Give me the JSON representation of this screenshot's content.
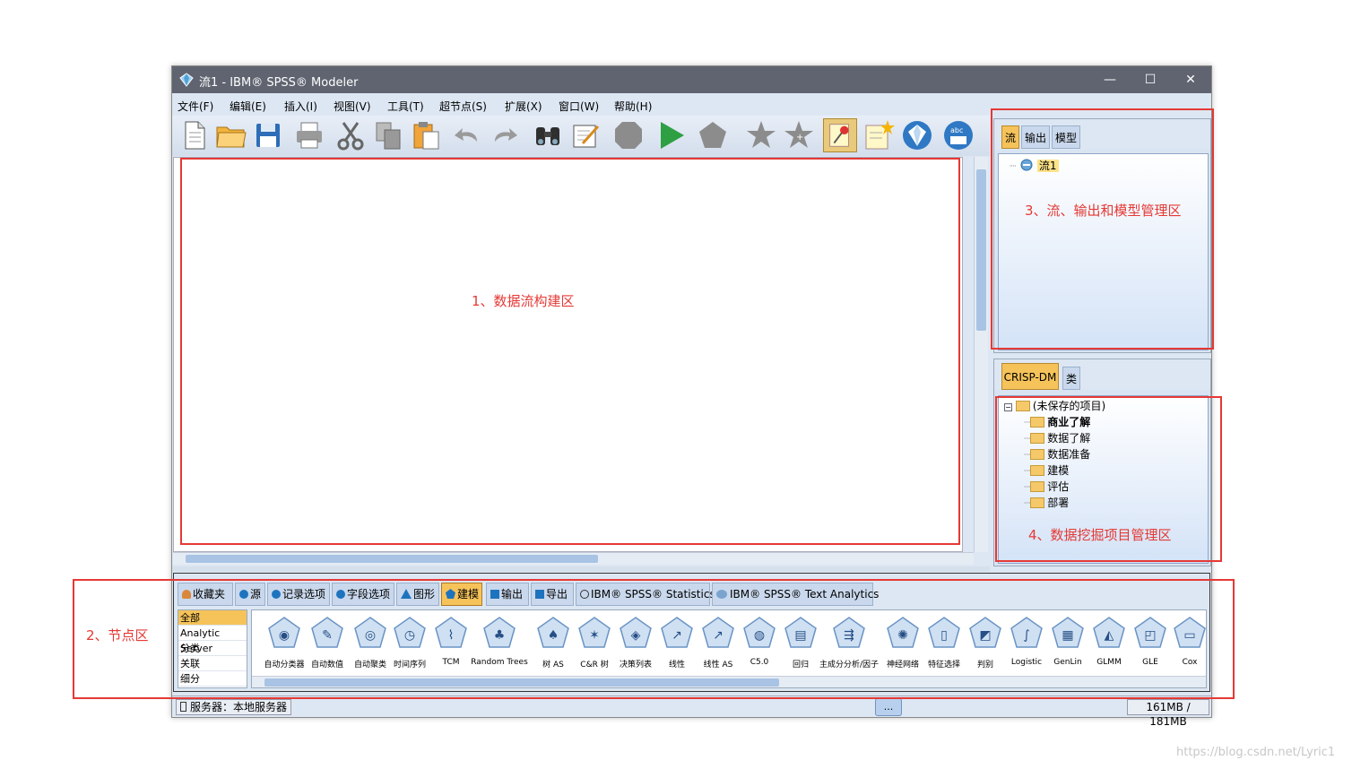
{
  "window": {
    "title": "流1 - IBM® SPSS® Modeler",
    "controls": {
      "minimize": "—",
      "maximize": "☐",
      "close": "✕"
    }
  },
  "menu": [
    "文件(F)",
    "编辑(E)",
    "插入(I)",
    "视图(V)",
    "工具(T)",
    "超节点(S)",
    "扩展(X)",
    "窗口(W)",
    "帮助(H)"
  ],
  "right_top": {
    "tabs": [
      "流",
      "输出",
      "模型"
    ],
    "stream_item": "流1"
  },
  "right_bottom": {
    "tabs": [
      "CRISP-DM",
      "类"
    ],
    "root": "(未保存的项目)",
    "folders": [
      "商业了解",
      "数据了解",
      "数据准备",
      "建模",
      "评估",
      "部署"
    ]
  },
  "palette": {
    "tabs": [
      "收藏夹",
      "源",
      "记录选项",
      "字段选项",
      "图形",
      "建模",
      "输出",
      "导出",
      "IBM® SPSS® Statistics",
      "IBM® SPSS® Text Analytics"
    ],
    "subcategories": [
      "全部",
      "Analytic Server",
      "分类",
      "关联",
      "细分"
    ],
    "nodes": [
      "自动分类器",
      "自动数值",
      "自动聚类",
      "时间序列",
      "TCM",
      "Random Trees",
      "树 AS",
      "C&R 树",
      "决策列表",
      "线性",
      "线性 AS",
      "C5.0",
      "回归",
      "主成分分析/因子",
      "神经网络",
      "特征选择",
      "判别",
      "Logistic",
      "GenLin",
      "GLMM",
      "GLE",
      "Cox"
    ]
  },
  "status": {
    "server": "服务器：本地服务器",
    "dots": "...",
    "memory": "161MB / 181MB"
  },
  "annotations": {
    "a1": "1、数据流构建区",
    "a2": "2、节点区",
    "a3": "3、流、输出和模型管理区",
    "a4": "4、数据挖掘项目管理区"
  },
  "watermark": "https://blog.csdn.net/Lyric1",
  "colors": {
    "accent_red": "#e53935",
    "tab_selected": "#f5c35a",
    "titlebar": "#5f6470"
  }
}
